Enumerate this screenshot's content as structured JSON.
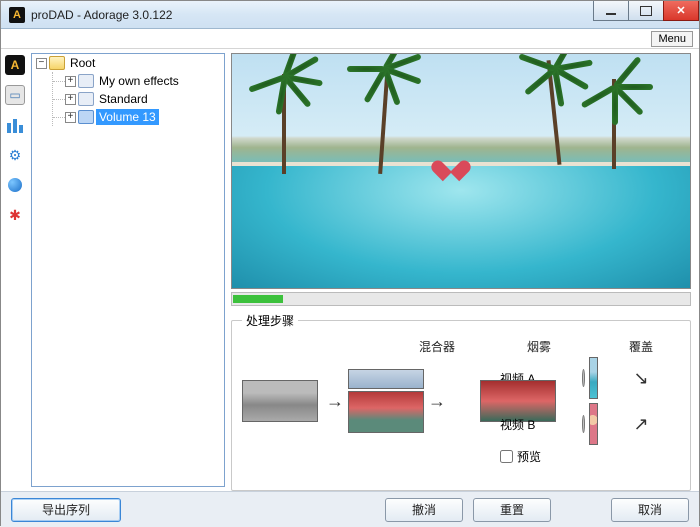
{
  "title": "proDAD - Adorage 3.0.122",
  "menu": {
    "label": "Menu"
  },
  "tree": {
    "root": "Root",
    "children": [
      {
        "label": "My own effects"
      },
      {
        "label": "Standard"
      },
      {
        "label": "Volume 13",
        "selected": true
      }
    ]
  },
  "sidebar_icons": [
    "A",
    "□",
    "III",
    "⚙",
    "●",
    "✿"
  ],
  "steps": {
    "title": "处理步骤",
    "videoA": "视频 A",
    "videoB": "视频 B",
    "mixer": "混合器",
    "smoke": "烟雾",
    "overlay": "覆盖",
    "preview_label": "预览"
  },
  "buttons": {
    "export": "导出序列",
    "undo": "撤消",
    "reset": "重置",
    "cancel": "取消"
  }
}
